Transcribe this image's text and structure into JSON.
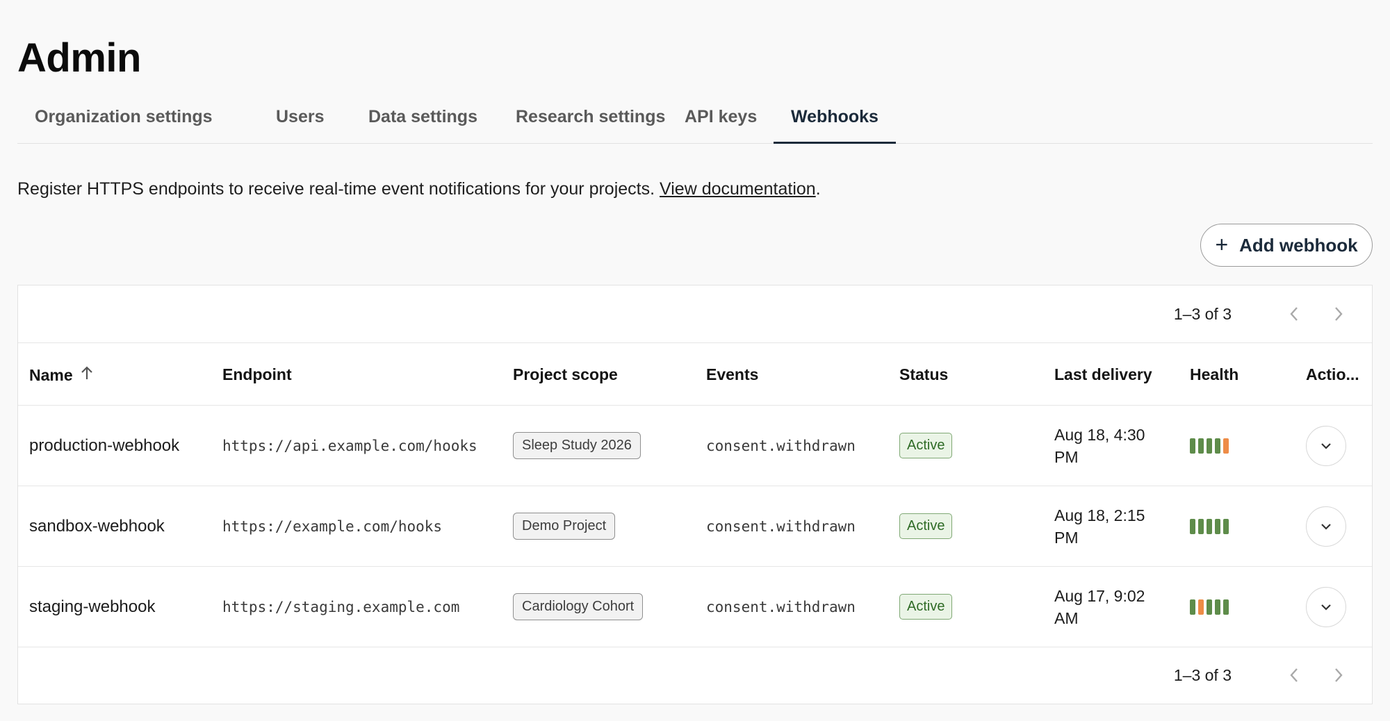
{
  "page": {
    "title": "Admin"
  },
  "tabs": [
    {
      "label": "Organization settings"
    },
    {
      "label": "Users"
    },
    {
      "label": "Data settings"
    },
    {
      "label": "Research settings"
    },
    {
      "label": "API keys"
    },
    {
      "label": "Webhooks"
    }
  ],
  "description": {
    "text": "Register HTTPS endpoints to receive real-time event notifications for your projects.",
    "link": "View documentation",
    "suffix": "."
  },
  "add_button": {
    "label": "Add webhook",
    "icon": "plus-icon"
  },
  "pagination": {
    "range": "1–3 of 3",
    "prev_icon": "chevron-left-icon",
    "next_icon": "chevron-right-icon"
  },
  "table": {
    "columns": {
      "name": "Name",
      "endpoint": "Endpoint",
      "project_scope": "Project scope",
      "events": "Events",
      "status": "Status",
      "last_delivery": "Last delivery",
      "health": "Health",
      "actions": "Actio..."
    },
    "sort_icon": "arrow-up-icon",
    "rows": [
      {
        "name": "production-webhook",
        "endpoint": "https://api.example.com/hooks",
        "project": "Sleep Study 2026",
        "events": "consent.withdrawn",
        "status": "Active",
        "delivery_line1": "Aug 18, 4:30",
        "delivery_line2": "PM",
        "health": [
          "success",
          "success",
          "success",
          "success",
          "warning"
        ]
      },
      {
        "name": "sandbox-webhook",
        "endpoint": "https://example.com/hooks",
        "project": "Demo Project",
        "events": "consent.withdrawn",
        "status": "Active",
        "delivery_line1": "Aug 18, 2:15",
        "delivery_line2": "PM",
        "health": [
          "success",
          "success",
          "success",
          "success",
          "success"
        ]
      },
      {
        "name": "staging-webhook",
        "endpoint": "https://staging.example.com",
        "project": "Cardiology Cohort",
        "events": "consent.withdrawn",
        "status": "Active",
        "delivery_line1": "Aug 17, 9:02",
        "delivery_line2": "AM",
        "health": [
          "success",
          "warning",
          "success",
          "success",
          "success"
        ]
      }
    ]
  },
  "colors": {
    "success": "#5e8c4a",
    "warning": "#ee8c47",
    "accent": "#1b2a3a"
  }
}
